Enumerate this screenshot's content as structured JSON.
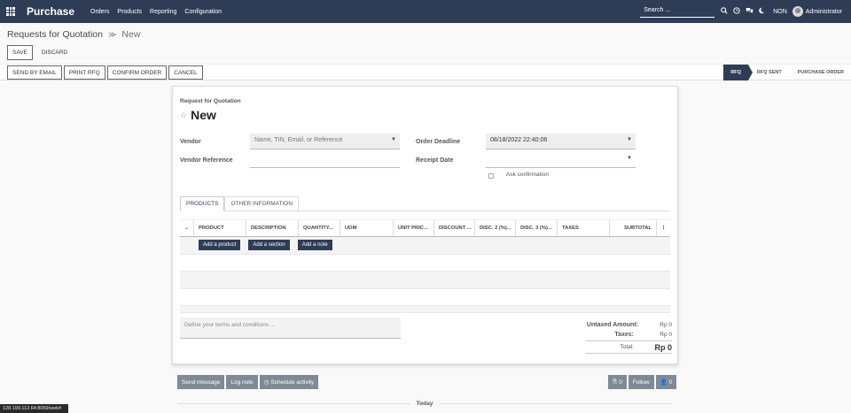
{
  "navbar": {
    "app_name": "Purchase",
    "menu": [
      "Orders",
      "Products",
      "Reporting",
      "Configuration"
    ],
    "search_placeholder": "Search ...",
    "company": "NON",
    "user": "Administrator"
  },
  "breadcrumb": {
    "parent": "Requests for Quotation",
    "current": "New"
  },
  "form_buttons": {
    "save": "SAVE",
    "discard": "DISCARD"
  },
  "actions": [
    "SEND BY EMAIL",
    "PRINT RFQ",
    "CONFIRM ORDER",
    "CANCEL"
  ],
  "status_steps": [
    "RFQ",
    "RFQ SENT",
    "PURCHASE ORDER"
  ],
  "sheet": {
    "label": "Request for Quotation",
    "title": "New",
    "vendor_label": "Vendor",
    "vendor_placeholder": "Name, TIN, Email, or Reference",
    "vendor_ref_label": "Vendor Reference",
    "deadline_label": "Order Deadline",
    "deadline_value": "08/18/2022 22:40:06",
    "receipt_label": "Receipt Date",
    "ask_confirmation": "Ask confirmation"
  },
  "tabs": [
    "PRODUCTS",
    "OTHER INFORMATION"
  ],
  "table": {
    "columns": [
      "PRODUCT",
      "DESCRIPTION",
      "QUANTITY...",
      "UOM",
      "UNIT PRIC...",
      "DISCOUNT ...",
      "DISC. 2 (%)...",
      "DISC. 3 (%)...",
      "TAXES",
      "SUBTOTAL"
    ],
    "add_product": "Add a product",
    "add_section": "Add a section",
    "add_note": "Add a note"
  },
  "terms_placeholder": "Define your terms and conditions ...",
  "totals": {
    "untaxed_label": "Untaxed Amount:",
    "untaxed_value": "Rp 0",
    "taxes_label": "Taxes:",
    "taxes_value": "Rp 0",
    "total_label": "Total:",
    "total_value": "Rp 0"
  },
  "chatter": {
    "send_message": "Send message",
    "log_note": "Log note",
    "schedule_activity": "Schedule activity",
    "attachments": "0",
    "follow": "Follow",
    "followers": "0",
    "today": "Today"
  },
  "status_url": "128.199.112.64:8069/web#"
}
